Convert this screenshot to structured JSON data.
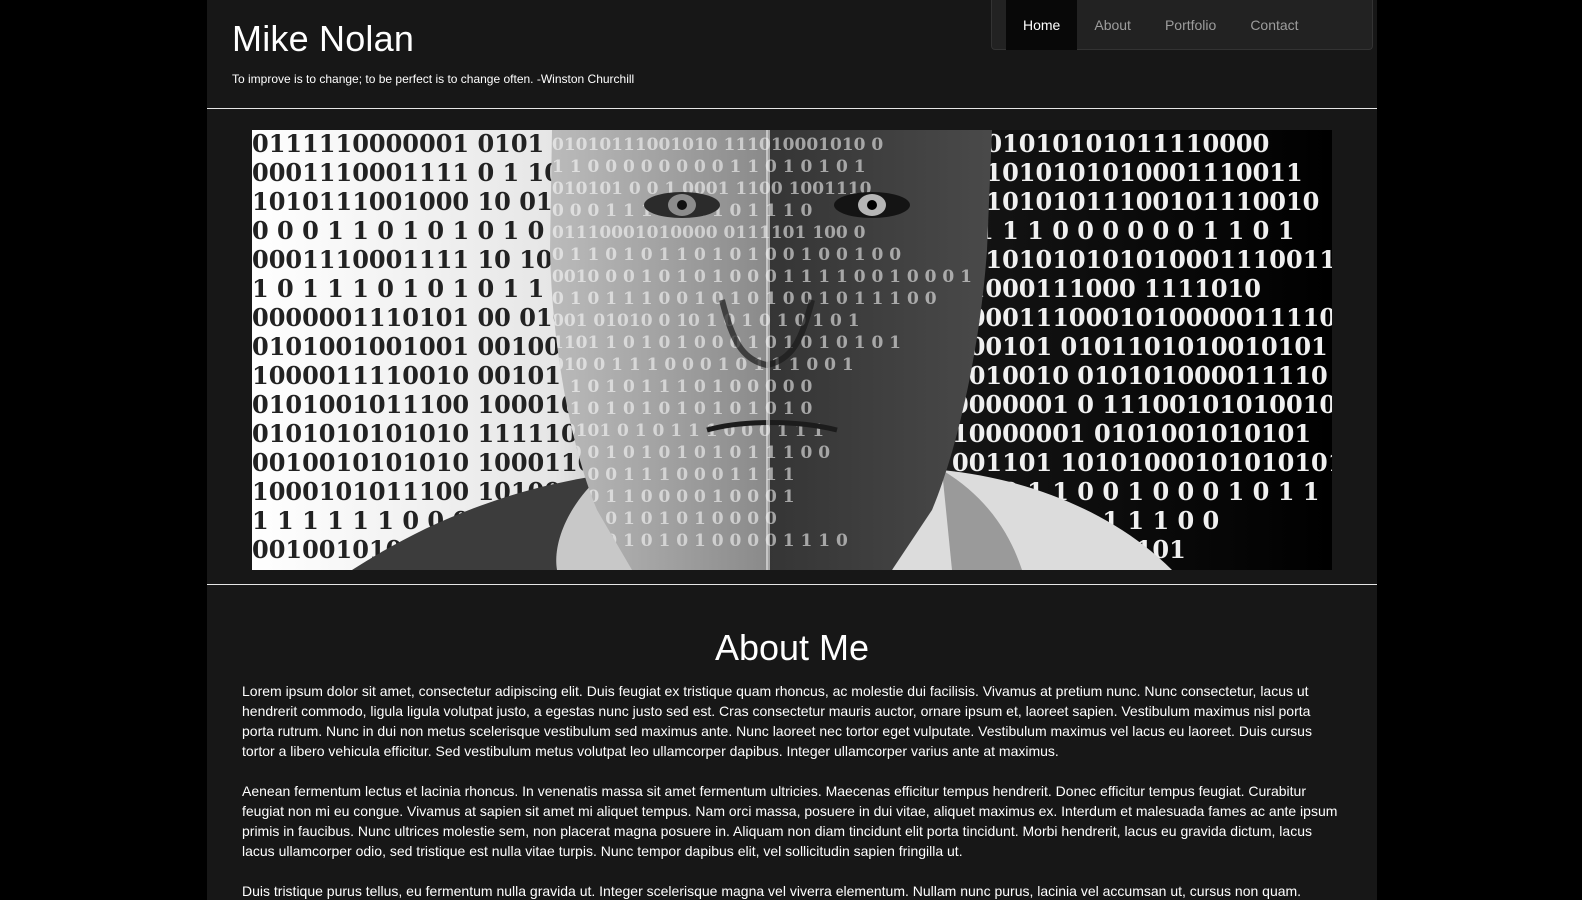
{
  "header": {
    "title": "Mike Nolan",
    "tagline": "To improve is to change; to be perfect is to change often. -Winston Churchill"
  },
  "nav": {
    "items": [
      {
        "label": "Home",
        "active": true
      },
      {
        "label": "About",
        "active": false
      },
      {
        "label": "Portfolio",
        "active": false
      },
      {
        "label": "Contact",
        "active": false
      }
    ]
  },
  "hero": {
    "left_binary_rows": [
      "0111110000001 0101",
      "0001110001111 0 1 1010",
      "1010111001000 10 0110",
      "0 0 0 1 1 0 1 0 1 0 1 0 1",
      "0001110001111 10 10101",
      "1 0 1 1 1 0 1 0 1 0 1 1 0 1 0",
      "0000001110101 00 01011",
      "0101001001001 001001",
      "1000011110010 0010100",
      "0101001011100 10001010",
      "0101010101010 1111100",
      "0010010101010 1000110",
      "1000101011100 101001",
      "1 1 1 1 1 1 0 0 0",
      "001001010"
    ],
    "right_binary_rows": [
      "0101010101011110000",
      "001010101010001110011",
      "0010101011100101110010",
      "1 1 1 1 0 0 0 0 0 0 1 1 0 1",
      "00101010101010001110011",
      "01000111000 1111010",
      "000011100010100000111101",
      "100101 0101101010010101",
      "0010010 010101000011110",
      "0000001 0 1110010101001011",
      "10000001 0101001010101",
      "001101 10101000101010101",
      "0 0 0 1 1 0 0 1 0 0 0 1 0 1 1",
      "1 0 1 0 1 1 1 1 1 0 0",
      "00100101010101"
    ],
    "face_binary_rows": [
      "01010111001010 111010001010 0",
      "1 1 0 0 0 0 0 0 0 0 1 1 0 1 0 1 0 1",
      "010101 0 0 1 0001 1100 1001110",
      "0 0 0 1 1 1 0 0 1 1 0 1 1 1 0",
      "01110001010000 0111101 100 0",
      "0 1 1 0 1 0 1 1 0 1 0 1 0 0 1 0 0 1 0 0",
      "0010 0 0 1 0 1 0 1 0 0 0 1 1 1 1 0 0 1 0 0 0 1",
      "0 1 0 1 1 1 0 0 1 0 1 0 1 0 0 1 0 1 1 1 0 0",
      "001 01010 0 10 1 0 1 0 1 0 1 0 1",
      "1101 1 0 1 0 1 0 0 0 1 0 1 0 1 0 1 0 1",
      "010 0 1 1 1 0 0 0 1 0 1 1 1 0 0 1",
      "0 1 0 1 0 1 1 1 0 1 0 0 0 0 0",
      "0 1 0 1 0 1 0 1 0 1 0 1 0 1 0",
      "00101 0 1 0 1 1 1 0 0 0 1 1 1",
      "1 0 0 1 0 1 0 1 0 1 0 1 1 1 0 0",
      "1 0 0 0 1 1 1 0 0 0 1 1 1 1",
      "0 0 0 1 1 0 0 0 0 1 0 0 0 1",
      "1 0 1 0 1 0 1 0 1 0 0 0 0",
      "0 0 1 0 1 0 1 0 1 0 0 0 0 1 1 1 0"
    ]
  },
  "about": {
    "title": "About Me",
    "paragraphs": [
      "Lorem ipsum dolor sit amet, consectetur adipiscing elit. Duis feugiat ex tristique quam rhoncus, ac molestie dui facilisis. Vivamus at pretium nunc. Nunc consectetur, lacus ut hendrerit commodo, ligula ligula volutpat justo, a egestas nunc justo sed est. Cras consectetur mauris auctor, ornare ipsum et, laoreet sapien. Vestibulum maximus nisl porta porta rutrum. Nunc in dui non metus scelerisque vestibulum sed maximus ante. Nunc laoreet nec tortor eget vulputate. Vestibulum maximus vel lacus eu laoreet. Duis cursus tortor a libero vehicula efficitur. Sed vestibulum metus volutpat leo ullamcorper dapibus. Integer ullamcorper varius ante at maximus.",
      "Aenean fermentum lectus et lacinia rhoncus. In venenatis massa sit amet fermentum ultricies. Maecenas efficitur tempus hendrerit. Donec efficitur tempus feugiat. Curabitur feugiat non mi eu congue. Vivamus at sapien sit amet mi aliquet tempus. Nam orci massa, posuere in dui vitae, aliquet maximus ex. Interdum et malesuada fames ac ante ipsum primis in faucibus. Nunc ultrices molestie sem, non placerat magna posuere in. Aliquam non diam tincidunt elit porta tincidunt. Morbi hendrerit, lacus eu gravida dictum, lacus lacus ullamcorper odio, sed tristique est nulla vitae turpis. Nunc tempor dapibus elit, vel sollicitudin sapien fringilla ut.",
      "Duis tristique purus tellus, eu fermentum nulla gravida ut. Integer scelerisque magna vel viverra elementum. Nullam nunc purus, lacinia vel accumsan ut, cursus non quam."
    ]
  },
  "colors": {
    "page_background": "#000000",
    "container_background": "#171717",
    "nav_background": "#222222",
    "nav_active_background": "#080808",
    "nav_text": "#9d9d9d",
    "text": "#ffffff",
    "divider": "#e6e6e6"
  }
}
